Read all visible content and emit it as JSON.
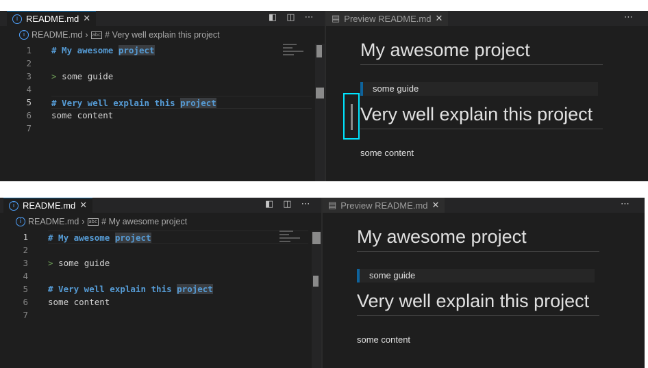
{
  "editor": {
    "tab_label": "README.md",
    "breadcrumb_file": "README.md",
    "lines": [
      {
        "num": "1",
        "parts": [
          {
            "t": "# My awesome ",
            "c": "heading"
          },
          {
            "t": "project",
            "c": "heading hl"
          }
        ]
      },
      {
        "num": "2",
        "parts": []
      },
      {
        "num": "3",
        "parts": [
          {
            "t": "> ",
            "c": "quote"
          },
          {
            "t": "some guide",
            "c": ""
          }
        ]
      },
      {
        "num": "4",
        "parts": []
      },
      {
        "num": "5",
        "parts": [
          {
            "t": "# Very well explain this ",
            "c": "heading"
          },
          {
            "t": "project",
            "c": "heading hl"
          }
        ]
      },
      {
        "num": "6",
        "parts": [
          {
            "t": "some content",
            "c": ""
          }
        ]
      },
      {
        "num": "7",
        "parts": []
      }
    ]
  },
  "preview": {
    "tab_label": "Preview README.md",
    "h1_first": "My awesome project",
    "quote": "some guide",
    "h1_second": "Very well explain this project",
    "paragraph": "some content"
  },
  "panel1": {
    "breadcrumb_symbol": "# Very well explain this project",
    "current_line": 5
  },
  "panel2": {
    "breadcrumb_symbol": "# My awesome project",
    "current_line": 1
  },
  "icons": {
    "info": "info-icon",
    "close": "close-icon",
    "split": "split-editor-icon",
    "preview_side": "open-preview-icon",
    "more": "more-actions-icon",
    "preview_file": "preview-file-icon",
    "symbol": "string-symbol-icon",
    "chevron": "chevron-right-icon"
  }
}
